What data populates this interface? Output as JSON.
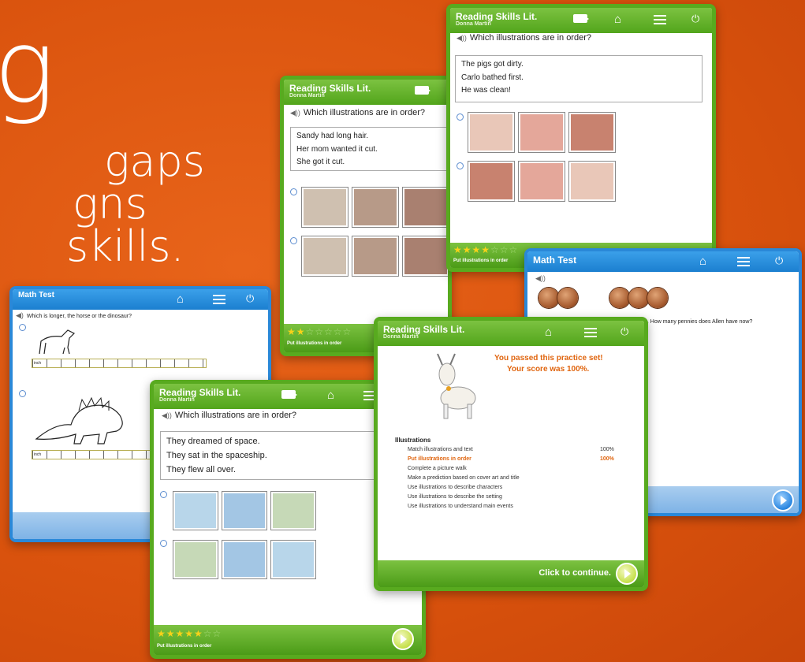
{
  "hero": {
    "big": "g",
    "line1": "gaps",
    "line2": "gns",
    "line3": "skills."
  },
  "reading": {
    "title": "Reading Skills Lit.",
    "subtitle": "Donna Martin",
    "question": "Which illustrations are in order?",
    "footer_label": "Put illustrations in order"
  },
  "panel_pigs": {
    "lines": [
      "The pigs got dirty.",
      "Carlo bathed first.",
      "He was clean!"
    ]
  },
  "panel_sandy": {
    "lines": [
      "Sandy had long hair.",
      "Her mom wanted it cut.",
      "She got it cut."
    ]
  },
  "panel_space": {
    "lines": [
      "They dreamed of space.",
      "They sat in the spaceship.",
      "They flew all over."
    ]
  },
  "math": {
    "title": "Math Test"
  },
  "math_horse": {
    "question": "Which is longer, the horse or the dinosaur?",
    "ruler_word": "inch"
  },
  "math_pennies": {
    "question": "e. How many pennies does Allen have now?"
  },
  "results": {
    "passed": "You passed this practice set!",
    "score": "Your score was 100%.",
    "heading": "Illustrations",
    "items": [
      {
        "label": "Match illustrations and text",
        "score": "100%"
      },
      {
        "label": "Put illustrations in order",
        "score": "100%"
      },
      {
        "label": "Complete a picture walk",
        "score": ""
      },
      {
        "label": "Make a prediction based on cover art and title",
        "score": ""
      },
      {
        "label": "Use illustrations to describe characters",
        "score": ""
      },
      {
        "label": "Use illustrations to describe the setting",
        "score": ""
      },
      {
        "label": "Use illustrations to understand main events",
        "score": ""
      }
    ],
    "continue": "Click to continue."
  },
  "colors": {
    "green": "#52a51b",
    "blue": "#1b7fd0",
    "orange": "#e0650f",
    "star": "#f7d219"
  },
  "icons": [
    "speaker-icon",
    "camera-icon",
    "home-icon",
    "menu-icon",
    "power-icon",
    "play-icon",
    "star-icon",
    "goat-icon"
  ]
}
